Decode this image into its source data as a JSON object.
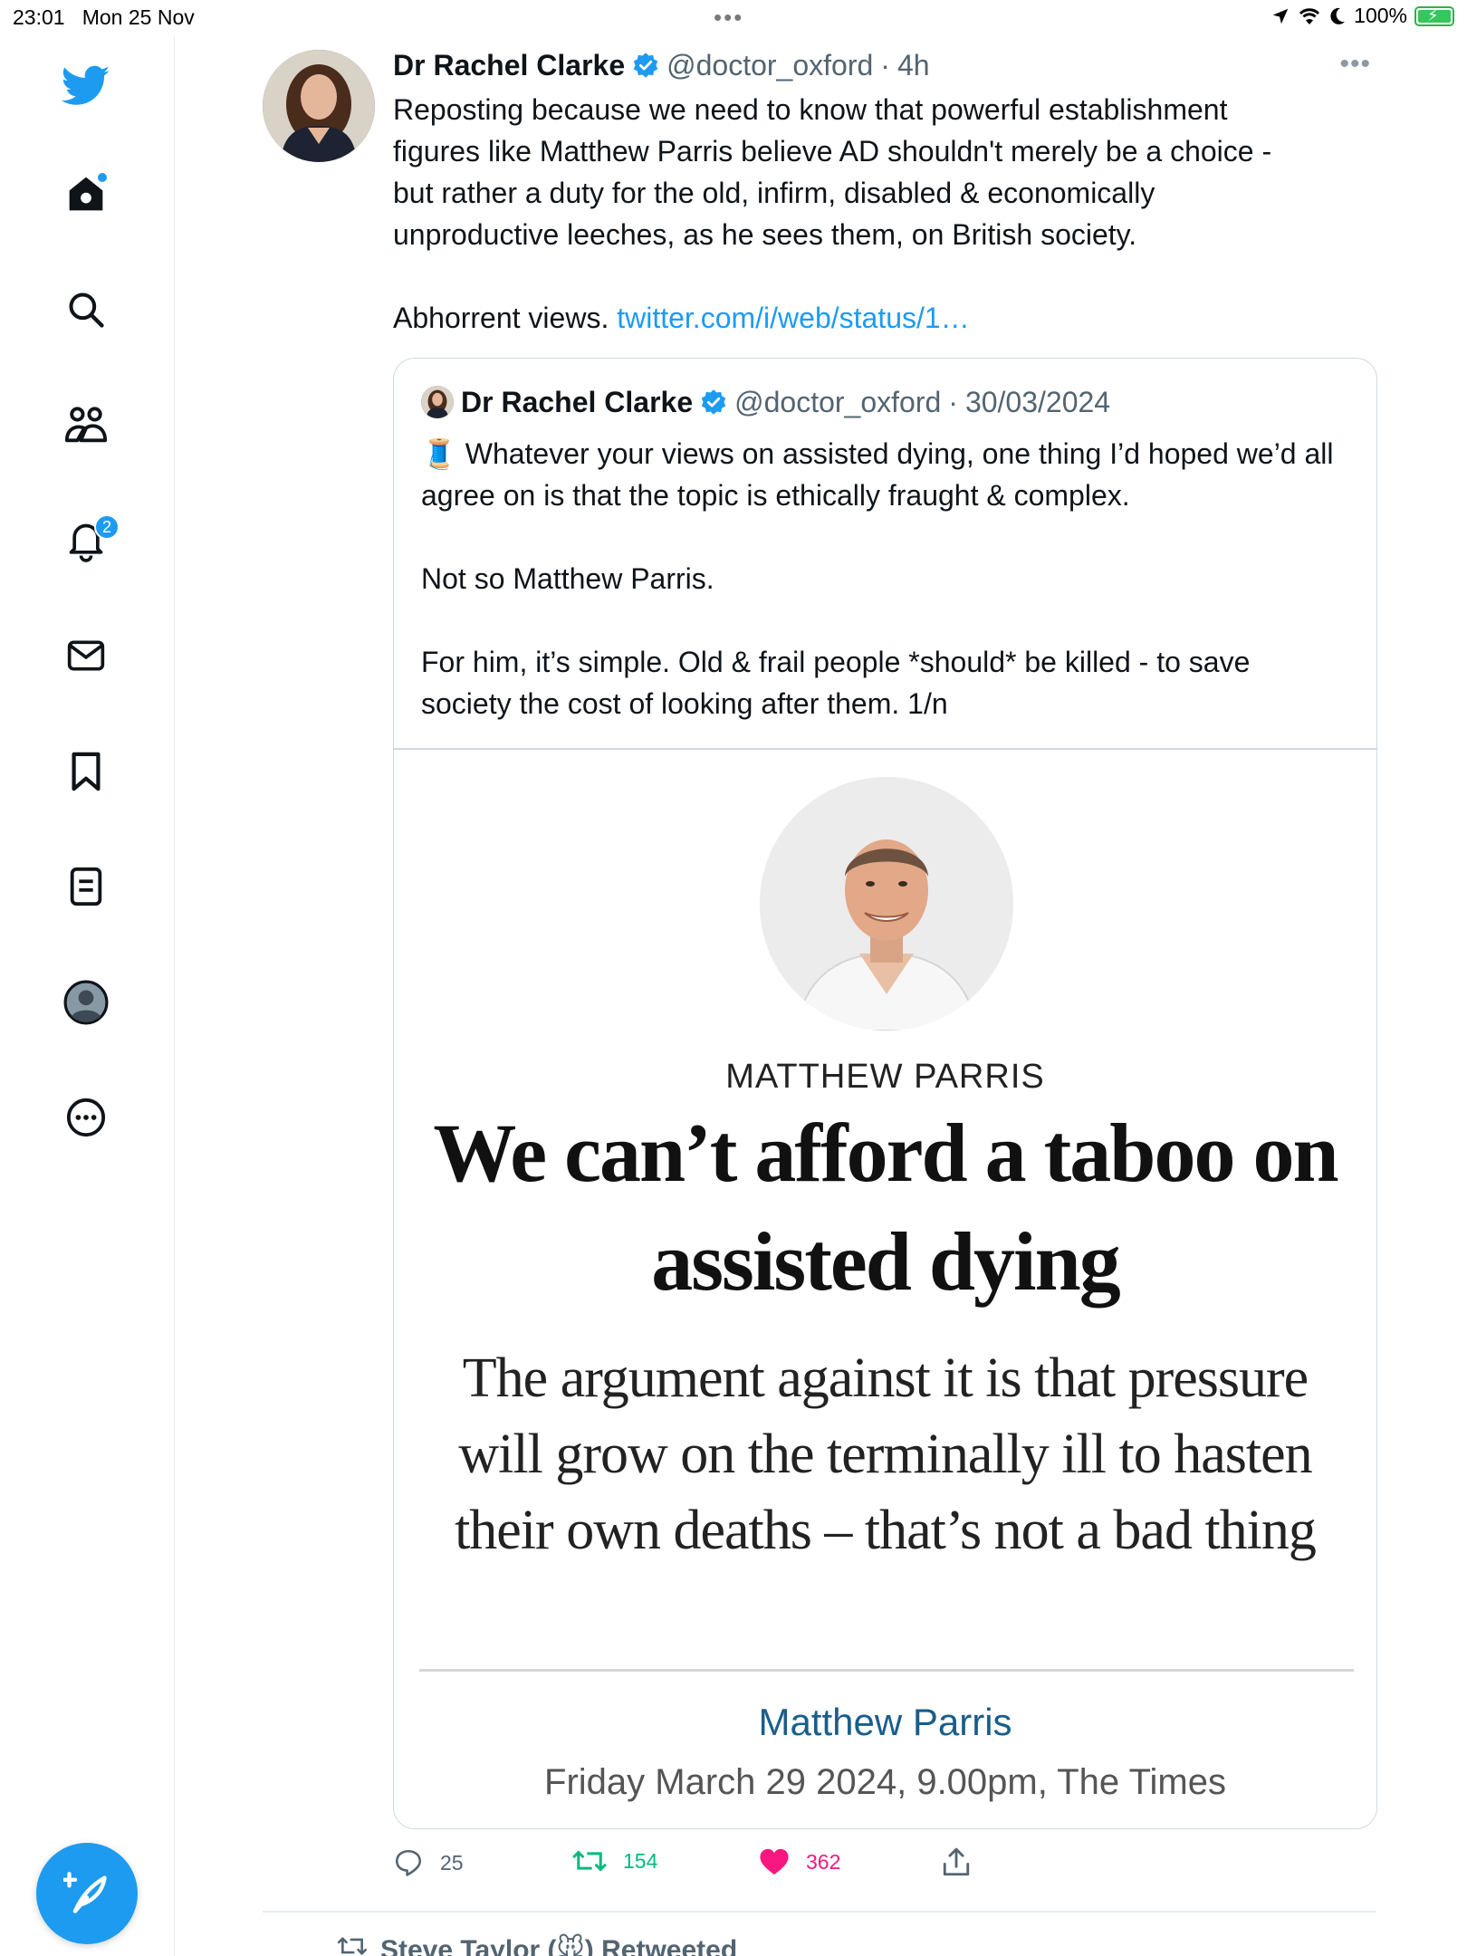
{
  "status_bar": {
    "time": "23:01",
    "date": "Mon 25 Nov",
    "center_dots": "•••",
    "battery": "100%"
  },
  "sidebar": {
    "items": [
      {
        "name": "twitter-logo-icon"
      },
      {
        "name": "home-icon"
      },
      {
        "name": "search-icon"
      },
      {
        "name": "communities-icon"
      },
      {
        "name": "notifications-icon",
        "badge": "2"
      },
      {
        "name": "messages-icon"
      },
      {
        "name": "bookmarks-icon"
      },
      {
        "name": "lists-icon"
      },
      {
        "name": "profile-icon"
      },
      {
        "name": "more-icon"
      }
    ],
    "accent": "#1d9bf0"
  },
  "tweet": {
    "author": "Dr Rachel Clarke",
    "handle": "@doctor_oxford",
    "separator": "·",
    "time": "4h",
    "more": "•••",
    "text_para1": "Reposting because we need to know that powerful establishment figures like Matthew Parris believe AD shouldn't merely be a choice - but rather a duty for the old, infirm, disabled & economically unproductive leeches, as he sees them, on British society.",
    "text_para2_prefix": "Abhorrent views. ",
    "text_link": "twitter.com/i/web/status/1…"
  },
  "quote": {
    "author": "Dr Rachel Clarke",
    "handle": "@doctor_oxford",
    "separator": "·",
    "date": "30/03/2024",
    "emoji": "🧵",
    "para1": " Whatever your views on assisted dying, one thing I’d hoped we’d all agree on is that the topic is ethically fraught & complex.",
    "para2": "Not so Matthew Parris.",
    "para3": "For him, it’s simple. Old & frail people *should* be killed - to save society the cost of looking after them. 1/n"
  },
  "article": {
    "author_caps": "MATTHEW PARRIS",
    "headline": "We can’t afford a taboo on assisted dying",
    "standfirst": "The argument against it is that pressure will grow on the terminally ill to hasten their own deaths – that’s not a bad thing",
    "byline": "Matthew Parris",
    "dateline": "Friday March 29 2024, 9.00pm, The Times"
  },
  "actions": {
    "replies": "25",
    "retweets": "154",
    "likes": "362",
    "colors": {
      "retweet": "#00ba7c",
      "like": "#f91880",
      "muted": "#536471"
    }
  },
  "next_item": {
    "label": "Steve Taylor (🐭) Retweeted"
  }
}
